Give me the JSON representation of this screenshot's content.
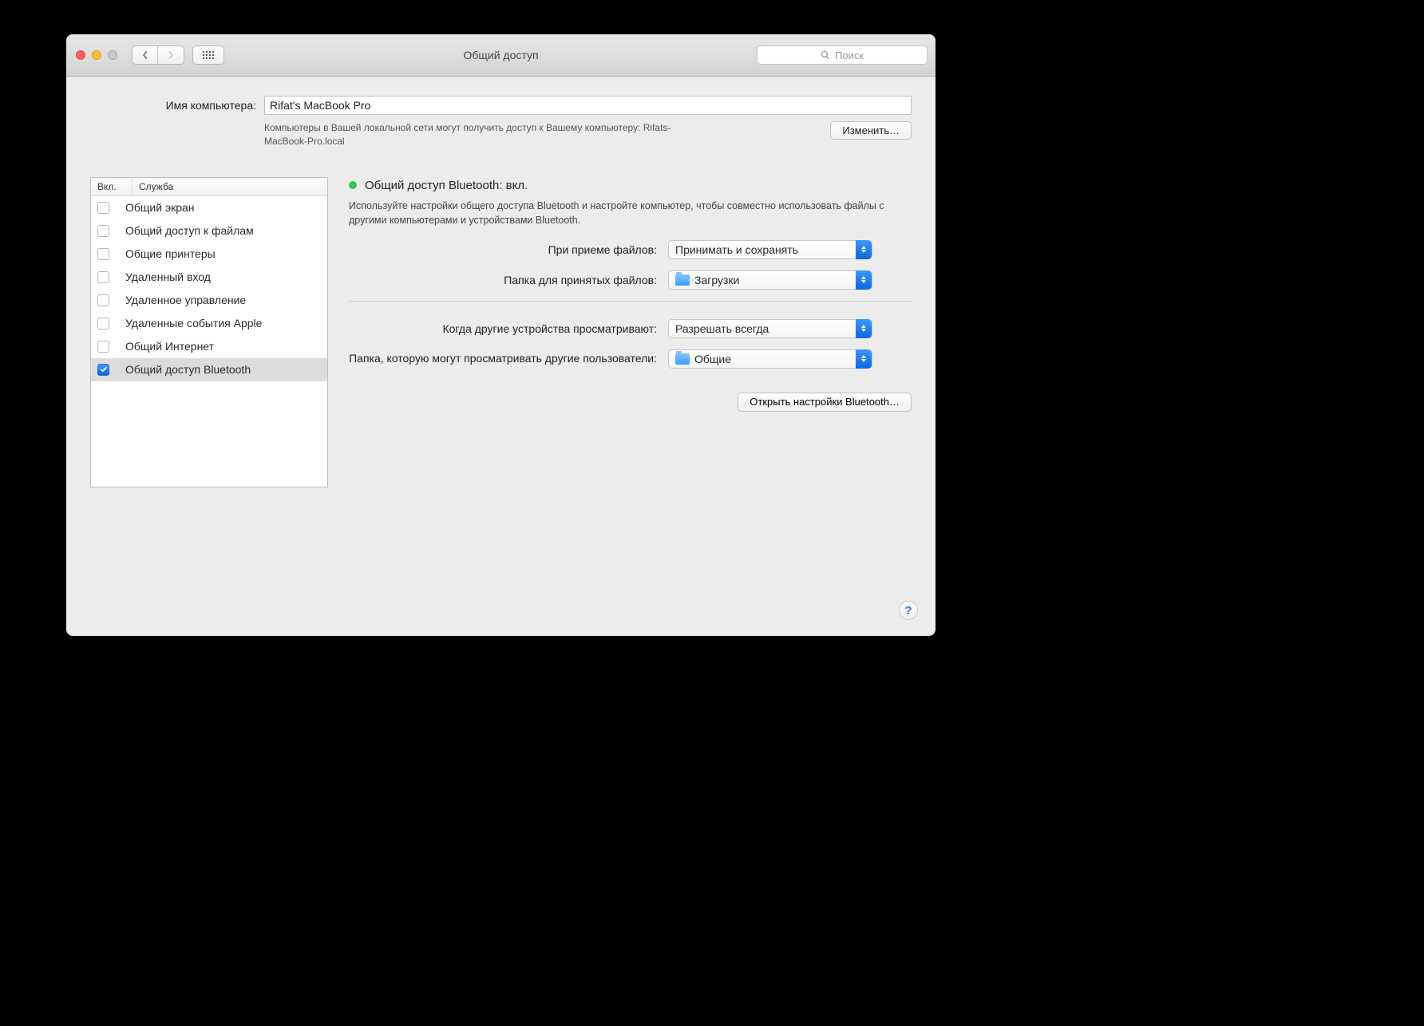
{
  "window": {
    "title": "Общий доступ",
    "search_placeholder": "Поиск"
  },
  "computer": {
    "label": "Имя компьютера:",
    "name": "Rifat's MacBook Pro",
    "subtext": "Компьютеры в Вашей локальной сети могут получить доступ к Вашему компьютеру: Rifats-MacBook-Pro.local",
    "edit_button": "Изменить…"
  },
  "service_table": {
    "col_on": "Вкл.",
    "col_service": "Служба",
    "rows": [
      {
        "label": "Общий экран",
        "on": false
      },
      {
        "label": "Общий доступ к файлам",
        "on": false
      },
      {
        "label": "Общие принтеры",
        "on": false
      },
      {
        "label": "Удаленный вход",
        "on": false
      },
      {
        "label": "Удаленное управление",
        "on": false
      },
      {
        "label": "Удаленные события Apple",
        "on": false
      },
      {
        "label": "Общий Интернет",
        "on": false
      },
      {
        "label": "Общий доступ Bluetooth",
        "on": true
      }
    ],
    "selected_index": 7
  },
  "detail": {
    "status": "Общий доступ Bluetooth: вкл.",
    "status_color": "#34c759",
    "description": "Используйте настройки общего доступа Bluetooth и настройте компьютер, чтобы совместно использовать файлы с другими компьютерами и устройствами Bluetooth.",
    "labels": {
      "on_receive": "При приеме файлов:",
      "receive_folder": "Папка для принятых файлов:",
      "on_browse": "Когда другие устройства просматривают:",
      "browse_folder": "Папка, которую могут просматривать другие пользователи:"
    },
    "values": {
      "on_receive": "Принимать и сохранять",
      "receive_folder": "Загрузки",
      "on_browse": "Разрешать всегда",
      "browse_folder": "Общие"
    },
    "open_bt_button": "Открыть настройки Bluetooth…"
  },
  "help": "?"
}
